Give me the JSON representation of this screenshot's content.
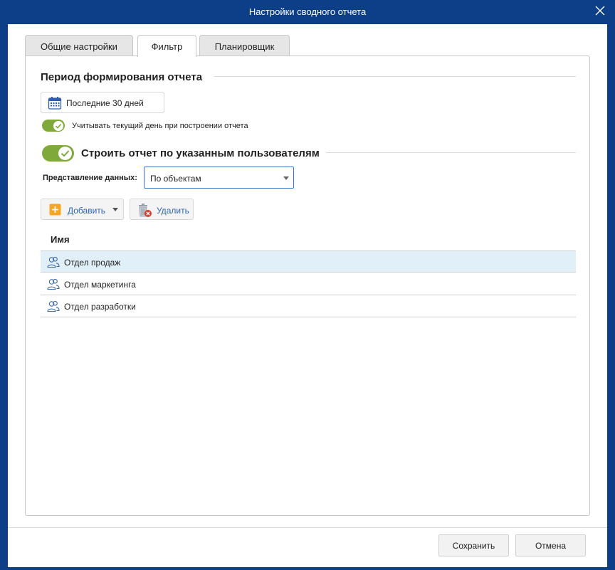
{
  "window": {
    "title": "Настройки сводного отчета"
  },
  "tabs": [
    {
      "label": "Общие настройки",
      "active": false
    },
    {
      "label": "Фильтр",
      "active": true
    },
    {
      "label": "Планировщик",
      "active": false
    }
  ],
  "period": {
    "section_title": "Период формирования отчета",
    "button_label": "Последние 30 дней",
    "include_today": {
      "label": "Учитывать текущий день при построении отчета",
      "checked": true
    }
  },
  "users": {
    "toggle_label": "Строить отчет по указанным пользователям",
    "toggle_checked": true,
    "representation_label": "Представление данных:",
    "representation_value": "По объектам"
  },
  "toolbar": {
    "add_label": "Добавить",
    "delete_label": "Удалить"
  },
  "list": {
    "column": "Имя",
    "rows": [
      {
        "name": "Отдел продаж",
        "selected": true
      },
      {
        "name": "Отдел маркетинга",
        "selected": false
      },
      {
        "name": "Отдел разработки",
        "selected": false
      }
    ]
  },
  "footer": {
    "save_label": "Сохранить",
    "cancel_label": "Отмена"
  },
  "colors": {
    "titlebar": "#0d3f88",
    "toggle_on": "#7fa93a",
    "selected_row": "#e1eff8",
    "link_text": "#2f64b4"
  }
}
